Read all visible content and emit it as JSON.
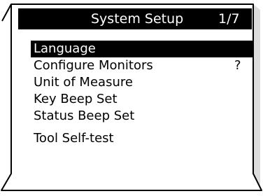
{
  "screen": {
    "title": "System Setup",
    "page_indicator": "1/7"
  },
  "menu": {
    "items": [
      {
        "label": "Language",
        "status": "",
        "selected": true
      },
      {
        "label": "Configure Monitors",
        "status": "?",
        "selected": false
      },
      {
        "label": "Unit of Measure",
        "status": "",
        "selected": false
      },
      {
        "label": "Key Beep Set",
        "status": "",
        "selected": false
      },
      {
        "label": "Status Beep Set",
        "status": "",
        "selected": false
      },
      {
        "label": "Tool Self-test",
        "status": "",
        "selected": false
      }
    ]
  },
  "colors": {
    "screen_background": "#ffffff",
    "title_bar": "#000000",
    "selection_highlight": "#000000",
    "bezel_line": "#000000",
    "bezel_shadow": "#dddddd"
  }
}
